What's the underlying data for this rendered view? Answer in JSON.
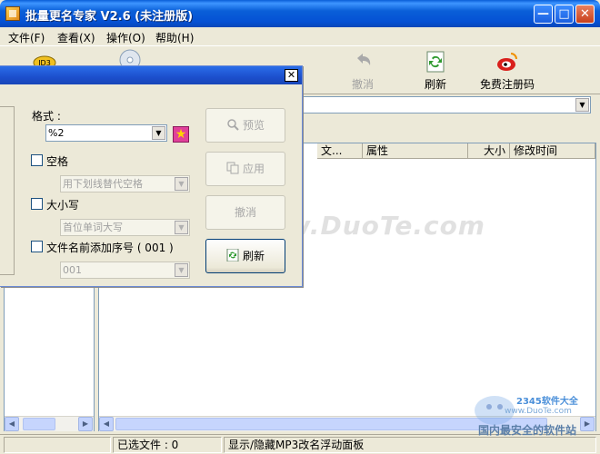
{
  "window": {
    "title": "批量更名专家 V2.6 (未注册版)",
    "min_glyph": "—",
    "max_glyph": "□",
    "close_glyph": "✕"
  },
  "menu": [
    {
      "label": "文件(F)"
    },
    {
      "label": "查看(X)"
    },
    {
      "label": "操作(O)"
    },
    {
      "label": "帮助(H)"
    }
  ],
  "toolbar": {
    "undo_label": "撤消",
    "refresh_label": "刷新",
    "register_label": "免费注册码"
  },
  "file_list": {
    "columns": [
      "文...",
      "属性",
      "大小",
      "修改时间"
    ]
  },
  "status": {
    "selected_files": "已选文件 : 0",
    "panel_toggle": "显示/隐藏MP3改名浮动面板"
  },
  "dialog": {
    "close_glyph": "✕",
    "format_label": "格式 :",
    "format_value": "%2",
    "space_label": "空格",
    "space_option": "用下划线替代空格",
    "case_label": "大小写",
    "case_option": "首位单词大写",
    "seq_label": "文件名前添加序号 ( 001 )",
    "seq_option": "001",
    "preview_button": "预览",
    "apply_button": "应用",
    "undo_button": "撤消",
    "refresh_button": "刷新"
  },
  "watermarks": {
    "duote": "www.DuoTe.com",
    "logo_line1": "2345软件大全",
    "logo_line2": "www.DuoTe.com",
    "logo_line3": "国内最安全的软件站"
  },
  "colors": {
    "title_blue": "#0a5fd8",
    "dialog_title_blue": "#1c4fcd",
    "window_bg": "#ece9d8",
    "register_icon_red": "#d9201c",
    "refresh_icon_green": "#2f9a2f"
  }
}
